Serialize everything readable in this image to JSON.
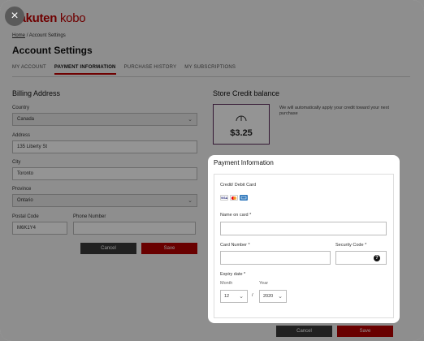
{
  "logo": {
    "rakuten": "rakuten",
    "kobo": "kobo"
  },
  "breadcrumb": {
    "home": "Home",
    "sep": "/",
    "current": "Account Settings"
  },
  "page_title": "Account Settings",
  "tabs": [
    {
      "label": "MY ACCOUNT",
      "active": false
    },
    {
      "label": "PAYMENT INFORMATION",
      "active": true
    },
    {
      "label": "PURCHASE HISTORY",
      "active": false
    },
    {
      "label": "MY SUBSCRIPTIONS",
      "active": false
    }
  ],
  "billing": {
    "title": "Billing Address",
    "country_label": "Country",
    "country_value": "Canada",
    "address_label": "Address",
    "address_value": "135 Liberty St",
    "city_label": "City",
    "city_value": "Toronto",
    "province_label": "Province",
    "province_value": "Ontario",
    "postal_label": "Postal Code",
    "postal_value": "M6K1Y4",
    "phone_label": "Phone Number",
    "phone_value": "",
    "cancel": "Cancel",
    "save": "Save"
  },
  "store_credit": {
    "title": "Store Credit balance",
    "amount": "$3.25",
    "note": "We will automatically apply your credit toward your next purchase"
  },
  "payment_modal": {
    "title": "Payment Information",
    "card_type_label": "Credit/ Debit Card",
    "card_icons": [
      "VISA",
      "mastercard",
      "AMEX"
    ],
    "name_label": "Name on card *",
    "name_value": "",
    "number_label": "Card Number *",
    "number_value": "",
    "security_label": "Security Code *",
    "security_value": "",
    "help_icon": "?",
    "expiry_label": "Expiry date *",
    "month_label": "Month",
    "month_value": "12",
    "separator": "/",
    "year_label": "Year",
    "year_value": "2020",
    "cancel": "Cancel",
    "save": "Save"
  },
  "close_icon": "×",
  "colors": {
    "brand_red": "#bf0000",
    "dark_button": "#3a3a3a",
    "overlay": "rgba(0,0,0,0.42)"
  }
}
